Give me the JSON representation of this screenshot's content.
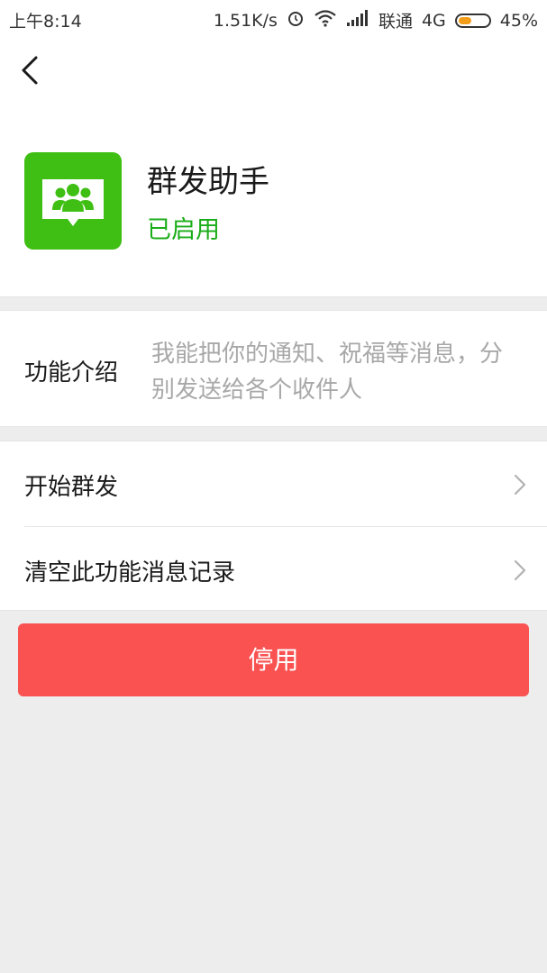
{
  "status_bar": {
    "time": "上午8:14",
    "net_speed": "1.51K/s",
    "carrier": "联通",
    "network": "4G",
    "battery": "45%",
    "battery_fraction": 0.45,
    "icons": [
      "alarm-icon",
      "wifi-icon",
      "signal-icon",
      "battery-icon"
    ]
  },
  "nav": {
    "back_icon": "chevron-left-icon"
  },
  "profile": {
    "icon": "group-chat-icon",
    "name": "群发助手",
    "status": "已启用"
  },
  "intro": {
    "label": "功能介绍",
    "text": "我能把你的通知、祝福等消息，分别发送给各个收件人"
  },
  "menu": {
    "items": [
      {
        "label": "开始群发",
        "icon": "chevron-right-icon"
      },
      {
        "label": "清空此功能消息记录",
        "icon": "chevron-right-icon"
      }
    ]
  },
  "actions": {
    "disable_label": "停用"
  },
  "colors": {
    "accent_green": "#1aad19",
    "icon_green": "#3fbf14",
    "danger_red": "#fa5151",
    "background": "#ededed",
    "battery_fill": "#f29d1a"
  }
}
